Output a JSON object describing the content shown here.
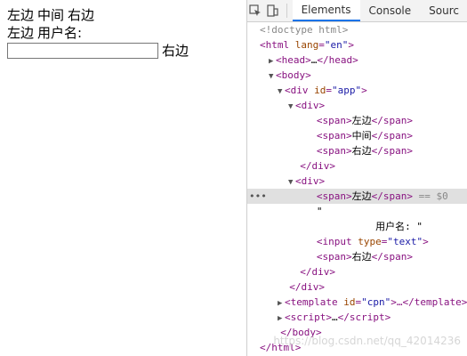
{
  "page": {
    "row1": [
      "左边",
      "中间",
      "右边"
    ],
    "row2": [
      "左边",
      "用户名:"
    ],
    "row3_right": "右边",
    "input_value": ""
  },
  "devtools": {
    "tabs": [
      "Elements",
      "Console",
      "Sourc"
    ],
    "active_tab": "Elements",
    "lines": {
      "doctype": "<!doctype html>",
      "html_lang": "\"en\"",
      "head_open": "<head>",
      "head_ellipsis": "…",
      "head_close": "</head>",
      "body_open": "<body>",
      "div_app_id": "\"app\"",
      "div1_open": "<div>",
      "span_zuo": "左边",
      "span_zhong": "中间",
      "span_you": "右边",
      "div_close": "</div>",
      "div2_open": "<div>",
      "sel_marker": "== $0",
      "quote_line": "\"",
      "username_text": "用户名: \"",
      "input_type": "\"text\"",
      "span_you2": "右边",
      "div_app_close": "</div>",
      "template_id": "\"cpn\"",
      "script_ellipsis": "…",
      "body_close": "</body>",
      "html_close": "</html>"
    }
  },
  "watermark": "https://blog.csdn.net/qq_42014236"
}
